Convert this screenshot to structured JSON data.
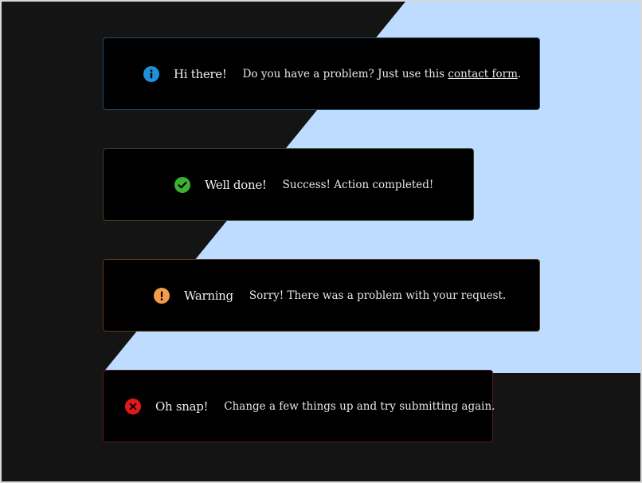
{
  "colors": {
    "background_dark": "#141414",
    "background_light": "#bedcff",
    "alert_bg": "#000000",
    "info": "#1e8fd8",
    "success": "#3bb031",
    "warning": "#f39c4a",
    "danger": "#e0191e"
  },
  "alerts": [
    {
      "type": "info",
      "icon": "info-icon",
      "title": "Hi there!",
      "message": "Do you have a problem? Just use this ",
      "link": "contact form",
      "message_suffix": "."
    },
    {
      "type": "success",
      "icon": "check-icon",
      "title": "Well done!",
      "message": "Success! Action completed!"
    },
    {
      "type": "warning",
      "icon": "exclamation-icon",
      "title": "Warning",
      "message": "Sorry! There was a problem with your request."
    },
    {
      "type": "danger",
      "icon": "close-icon",
      "title": "Oh snap!",
      "message": "Change a few things up and try submitting again."
    }
  ]
}
